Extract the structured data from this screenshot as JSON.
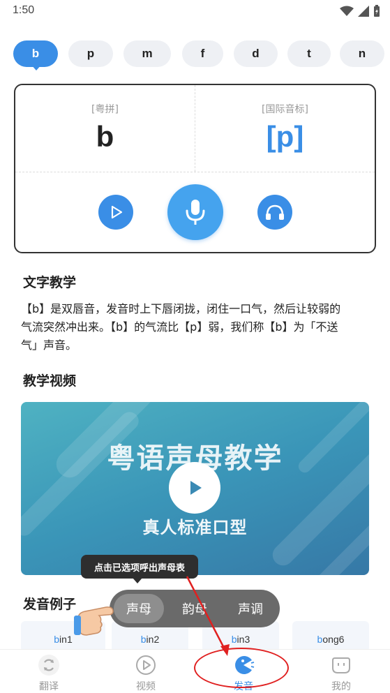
{
  "status": {
    "time": "1:50"
  },
  "initials": [
    "b",
    "p",
    "m",
    "f",
    "d",
    "t",
    "n"
  ],
  "card": {
    "jyutping_label": "[粤拼]",
    "jyutping_value": "b",
    "ipa_label": "[国际音标]",
    "ipa_value": "[p]"
  },
  "text_section": {
    "title": "文字教学",
    "line1": "【b】是双唇音，发音时上下唇闭拢，闭住一口气，然后让较弱的",
    "line2": "气流突然冲出来。【b】的气流比【p】弱，我们称【b】为「不送",
    "line3": "气」声音。"
  },
  "video_section": {
    "title": "教学视频",
    "video_title": "粤语声母教学",
    "video_subtitle": "真人标准口型"
  },
  "examples_section": {
    "title": "发音例子",
    "items": [
      "bin1",
      "bin2",
      "bin3",
      "bong6"
    ]
  },
  "tooltip": {
    "text": "点击已选项呼出声母表"
  },
  "segment_popup": {
    "items": [
      "声母",
      "韵母",
      "声调"
    ]
  },
  "tabbar": {
    "items": [
      "翻译",
      "视频",
      "发音",
      "我的"
    ]
  },
  "colors": {
    "accent": "#3a8ee6",
    "annotation_red": "#e02020"
  },
  "icons": {
    "play": "play-icon",
    "mic": "microphone-icon",
    "headphones": "headphones-icon",
    "translate": "refresh-icon",
    "video": "video-play-icon",
    "pronounce": "pacman-icon",
    "me": "face-icon"
  }
}
